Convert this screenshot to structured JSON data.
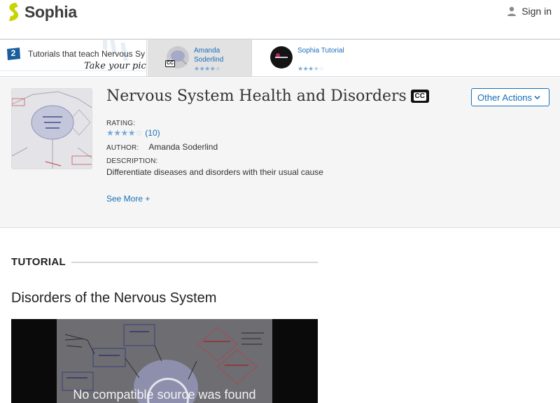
{
  "header": {
    "logo_text": "Sophia",
    "signin_label": "Sign in",
    "logo_color": "#c8d400"
  },
  "strip": {
    "count": "2",
    "title": "Tutorials that teach Nervous Sy",
    "pick": "Take your pick:",
    "options": [
      {
        "author_line1": "Amanda",
        "author_line2": "Soderlind",
        "stars": "★★★★",
        "stars_off": "★",
        "cc": "CC"
      },
      {
        "author": "Sophia Tutorial",
        "stars": "★★★",
        "stars_half": "★",
        "stars_off": "☆"
      }
    ]
  },
  "info": {
    "title": "Nervous System Health and Disorders",
    "cc_label": "CC",
    "other_actions_label": "Other Actions",
    "rating_label": "RATING:",
    "rating_stars": "★★★★",
    "rating_stars_off": "☆",
    "rating_count": "(10)",
    "author_label": "AUTHOR:",
    "author_name": "Amanda Soderlind",
    "description_label": "DESCRIPTION:",
    "description": "Differentiate diseases and disorders with their usual cause",
    "see_more": "See More +"
  },
  "tutorial": {
    "section_label": "TUTORIAL",
    "title": "Disorders of the Nervous System",
    "video_message": "No compatible source was found"
  },
  "colors": {
    "link": "#1a6fb8",
    "panel_bg": "#f5f5f5"
  }
}
